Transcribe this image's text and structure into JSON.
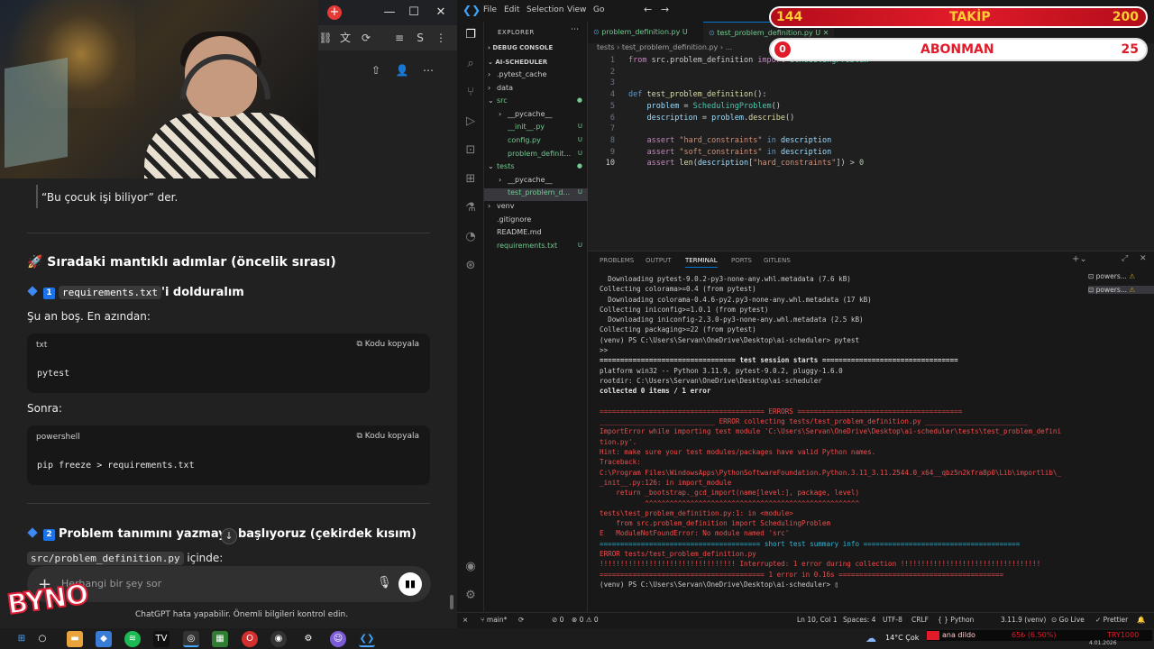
{
  "chat": {
    "quote": "“Bu çocuk işi biliyor” der.",
    "section_title": "🚀 Sıradaki mantıklı adımlar (öncelik sırası)",
    "step1": {
      "num": "1",
      "code": "requirements.txt",
      "rest": "'i dolduralım"
    },
    "empty_note": "Şu an boş. En azından:",
    "block1": {
      "lang": "txt",
      "copy": "Kodu kopyala",
      "code": "pytest"
    },
    "then": "Sonra:",
    "block2": {
      "lang": "powershell",
      "copy": "Kodu kopyala",
      "code": "pip freeze > requirements.txt"
    },
    "step2": {
      "num": "2",
      "text": "Problem tanımını yazmaya başlıyoruz (çekirdek kısım)"
    },
    "file_code": "src/problem_definition.py",
    "file_rest": " içinde:",
    "input_placeholder": "Herhangi bir şey sor",
    "disclaimer": "ChatGPT hata yapabilir. Önemli bilgileri kontrol edin.",
    "logo": "BYNO"
  },
  "vscode": {
    "menu": [
      "File",
      "Edit",
      "Selection",
      "View",
      "Go"
    ],
    "explorer_title": "EXPLORER",
    "debug_console": "DEBUG CONSOLE",
    "project": "AI-SCHEDULER",
    "tree": [
      {
        "label": ".pytest_cache",
        "indent": 1,
        "arrow": "›",
        "u": ""
      },
      {
        "label": "data",
        "indent": 1,
        "arrow": "›",
        "u": ""
      },
      {
        "label": "src",
        "indent": 1,
        "arrow": "⌄",
        "u": "●"
      },
      {
        "label": "__pycache__",
        "indent": 2,
        "arrow": "›",
        "u": ""
      },
      {
        "label": "__init__.py",
        "indent": 2,
        "arrow": "",
        "u": "U"
      },
      {
        "label": "config.py",
        "indent": 2,
        "arrow": "",
        "u": "U"
      },
      {
        "label": "problem_definit...",
        "indent": 2,
        "arrow": "",
        "u": "U"
      },
      {
        "label": "tests",
        "indent": 1,
        "arrow": "⌄",
        "u": "●"
      },
      {
        "label": "__pycache__",
        "indent": 2,
        "arrow": "›",
        "u": ""
      },
      {
        "label": "test_problem_d...",
        "indent": 2,
        "arrow": "",
        "u": "U"
      },
      {
        "label": "venv",
        "indent": 1,
        "arrow": "›",
        "u": ""
      },
      {
        "label": ".gitignore",
        "indent": 1,
        "arrow": "",
        "u": ""
      },
      {
        "label": "README.md",
        "indent": 1,
        "arrow": "",
        "u": ""
      },
      {
        "label": "requirements.txt",
        "indent": 1,
        "arrow": "",
        "u": "U"
      }
    ],
    "tabs": [
      {
        "label": "problem_definition.py U"
      },
      {
        "label": "test_problem_definition.py U"
      }
    ],
    "breadcrumb": "tests  ›  test_problem_definition.py  ›  ...",
    "panel_tabs": [
      "PROBLEMS",
      "OUTPUT",
      "TERMINAL",
      "PORTS",
      "GITLENS"
    ],
    "term_sessions": [
      "powers...",
      "powers..."
    ],
    "status": {
      "branch": "main*",
      "errors": "⊗ 0 ⚠ 0",
      "ports": "⊘ 0",
      "pos": "Ln 10, Col 1",
      "spaces": "Spaces: 4",
      "enc": "UTF-8",
      "eol": "CRLF",
      "lang": "{ } Python",
      "ver": "3.11.9 (venv)",
      "live": "⊙ Go Live",
      "prettier": "✓ Prettier"
    }
  },
  "code_lines": [
    {
      "n": "1",
      "html": "<span class='kw2'>from</span> src.problem_definition <span class='kw2'>import</span> <span class='cls'>SchedulingProblem</span>"
    },
    {
      "n": "2",
      "html": ""
    },
    {
      "n": "3",
      "html": ""
    },
    {
      "n": "4",
      "html": "<span class='kw'>def</span> <span class='fn'>test_problem_definition</span>():"
    },
    {
      "n": "5",
      "html": "    <span class='var'>problem</span> = <span class='cls'>SchedulingProblem</span>()"
    },
    {
      "n": "6",
      "html": "    <span class='var'>description</span> = <span class='var'>problem</span>.<span class='fn'>describe</span>()"
    },
    {
      "n": "7",
      "html": ""
    },
    {
      "n": "8",
      "html": "    <span class='kw2'>assert</span> <span class='st'>\"hard_constraints\"</span> <span class='kw'>in</span> <span class='var'>description</span>"
    },
    {
      "n": "9",
      "html": "    <span class='kw2'>assert</span> <span class='st'>\"soft_constraints\"</span> <span class='kw'>in</span> <span class='var'>description</span>"
    },
    {
      "n": "10",
      "html": "    <span class='kw2'>assert</span> <span class='fn'>len</span>(<span class='var'>description</span>[<span class='st'>\"hard_constraints\"</span>]) > <span class='num'>0</span>"
    }
  ],
  "terminal": [
    {
      "c": "",
      "t": "  Downloading pytest-9.0.2-py3-none-any.whl.metadata (7.6 kB)"
    },
    {
      "c": "",
      "t": "Collecting colorama>=0.4 (from pytest)"
    },
    {
      "c": "",
      "t": "  Downloading colorama-0.4.6-py2.py3-none-any.whl.metadata (17 kB)"
    },
    {
      "c": "",
      "t": "Collecting iniconfig>=1.0.1 (from pytest)"
    },
    {
      "c": "",
      "t": "  Downloading iniconfig-2.3.0-py3-none-any.whl.metadata (2.5 kB)"
    },
    {
      "c": "",
      "t": "Collecting packaging>=22 (from pytest)"
    },
    {
      "c": "",
      "t": "(venv) PS C:\\Users\\Servan\\OneDrive\\Desktop\\ai-scheduler> pytest"
    },
    {
      "c": "",
      "t": ">>"
    },
    {
      "c": "bld",
      "t": "================================= test session starts ================================="
    },
    {
      "c": "",
      "t": "platform win32 -- Python 3.11.9, pytest-9.0.2, pluggy-1.6.0"
    },
    {
      "c": "",
      "t": "rootdir: C:\\Users\\Servan\\OneDrive\\Desktop\\ai-scheduler"
    },
    {
      "c": "bld",
      "t": "collected 0 items / 1 error"
    },
    {
      "c": "",
      "t": ""
    },
    {
      "c": "red",
      "t": "======================================== ERRORS ========================================"
    },
    {
      "c": "red",
      "t": "____________________________ ERROR collecting tests/test_problem_definition.py _________________________"
    },
    {
      "c": "red",
      "t": "ImportError while importing test module 'C:\\Users\\Servan\\OneDrive\\Desktop\\ai-scheduler\\tests\\test_problem_defini"
    },
    {
      "c": "red",
      "t": "tion.py'."
    },
    {
      "c": "red",
      "t": "Hint: make sure your test modules/packages have valid Python names."
    },
    {
      "c": "red",
      "t": "Traceback:"
    },
    {
      "c": "red",
      "t": "C:\\Program Files\\WindowsApps\\PythonSoftwareFoundation.Python.3.11_3.11.2544.0_x64__qbz5n2kfra8p0\\Lib\\importlib\\_"
    },
    {
      "c": "red",
      "t": "_init__.py:126: in import_module"
    },
    {
      "c": "red",
      "t": "    return _bootstrap._gcd_import(name[level:], package, level)"
    },
    {
      "c": "red",
      "t": "           ^^^^^^^^^^^^^^^^^^^^^^^^^^^^^^^^^^^^^^^^^^^^^^^^^^^^"
    },
    {
      "c": "red",
      "t": "tests\\test_problem_definition.py:1: in <module>"
    },
    {
      "c": "red",
      "t": "    from src.problem_definition import SchedulingProblem"
    },
    {
      "c": "red",
      "t": "E   ModuleNotFoundError: No module named 'src'"
    },
    {
      "c": "cyn",
      "t": "======================================= short test summary info ======================================"
    },
    {
      "c": "red",
      "t": "ERROR tests/test_problem_definition.py"
    },
    {
      "c": "red",
      "t": "!!!!!!!!!!!!!!!!!!!!!!!!!!!!!!!!! Interrupted: 1 error during collection !!!!!!!!!!!!!!!!!!!!!!!!!!!!!!!!!!"
    },
    {
      "c": "red",
      "t": "======================================== 1 error in 0.16s ========================================"
    },
    {
      "c": "",
      "t": "(venv) PS C:\\Users\\Servan\\OneDrive\\Desktop\\ai-scheduler> ▯"
    }
  ],
  "overlay": {
    "follow_count": "144",
    "follow_label": "TAKİP",
    "follow_goal": "200",
    "sub_count": "0",
    "sub_label": "ABONMAN",
    "sub_goal": "25"
  },
  "taskbar": {
    "weather": "14°C  Çok",
    "ticker1": "ana dildo",
    "ticker2": "65₺ (6.50%)",
    "ticker3": "TRY1000",
    "date": "4.01.2026"
  },
  "colors": {
    "accent": "#0078d4",
    "error": "#f14c4c",
    "overlay_red": "#e11b2a"
  }
}
